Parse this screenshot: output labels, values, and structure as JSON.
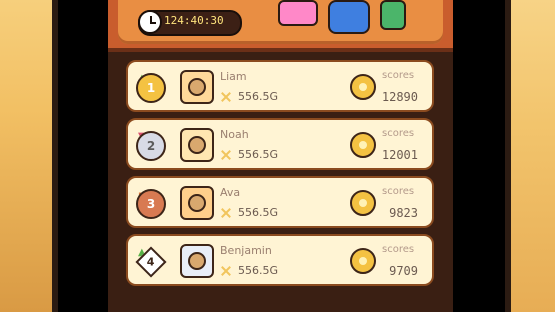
{
  "timer": {
    "text": "124:40:30"
  },
  "rows": [
    {
      "change": "up",
      "rank": "1",
      "badge": "gold",
      "name": "Liam",
      "power": "556.5G",
      "scores_label": "scores",
      "score": "12890"
    },
    {
      "change": "down",
      "rank": "2",
      "badge": "silver",
      "name": "Noah",
      "power": "556.5G",
      "scores_label": "scores",
      "score": "12001"
    },
    {
      "change": "same",
      "rank": "3",
      "badge": "bronze",
      "name": "Ava",
      "power": "556.5G",
      "scores_label": "scores",
      "score": "9823"
    },
    {
      "change": "up",
      "rank": "4",
      "badge": "diamond",
      "name": "Benjamin",
      "power": "556.5G",
      "scores_label": "scores",
      "score": "9709"
    }
  ]
}
